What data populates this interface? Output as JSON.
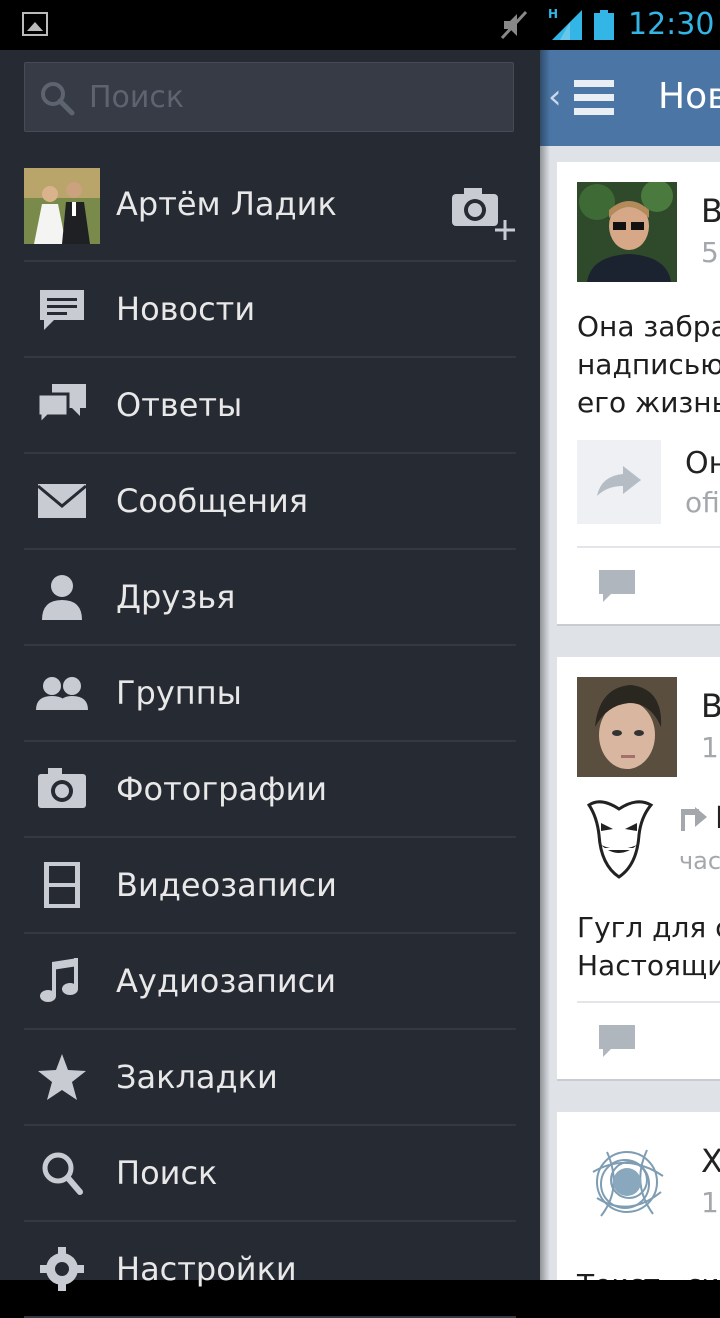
{
  "status_bar": {
    "time": "12:30",
    "network": "H",
    "icons": [
      "gallery-icon",
      "mute-icon",
      "signal-icon",
      "battery-icon"
    ]
  },
  "drawer": {
    "search": {
      "placeholder": "Поиск",
      "value": ""
    },
    "profile": {
      "name": "Артём Ладик"
    },
    "menu": [
      {
        "label": "Новости",
        "icon": "news-icon"
      },
      {
        "label": "Ответы",
        "icon": "replies-icon"
      },
      {
        "label": "Сообщения",
        "icon": "envelope-icon"
      },
      {
        "label": "Друзья",
        "icon": "person-icon"
      },
      {
        "label": "Группы",
        "icon": "people-icon"
      },
      {
        "label": "Фотографии",
        "icon": "camera-icon"
      },
      {
        "label": "Видеозаписи",
        "icon": "film-icon"
      },
      {
        "label": "Аудиозаписи",
        "icon": "music-note-icon"
      },
      {
        "label": "Закладки",
        "icon": "star-icon"
      },
      {
        "label": "Поиск",
        "icon": "search-icon"
      },
      {
        "label": "Настройки",
        "icon": "gear-icon"
      }
    ]
  },
  "news": {
    "title": "Нов",
    "posts": [
      {
        "author": "В",
        "time": "5",
        "text": [
          "Она забра",
          "надписью",
          "его жизнь"
        ],
        "share_title": "Он",
        "share_source": "ofi"
      },
      {
        "author": "В",
        "time": "1:",
        "repost_author": "L",
        "repost_time": "час",
        "text": [
          "Гугл для с",
          "Настоящи"
        ]
      },
      {
        "author": "Х",
        "time": "14",
        "text": [
          "Текст «си"
        ]
      }
    ]
  },
  "colors": {
    "drawer_bg": "#262a33",
    "actionbar": "#4a75a4",
    "status_accent": "#33b5e5"
  }
}
